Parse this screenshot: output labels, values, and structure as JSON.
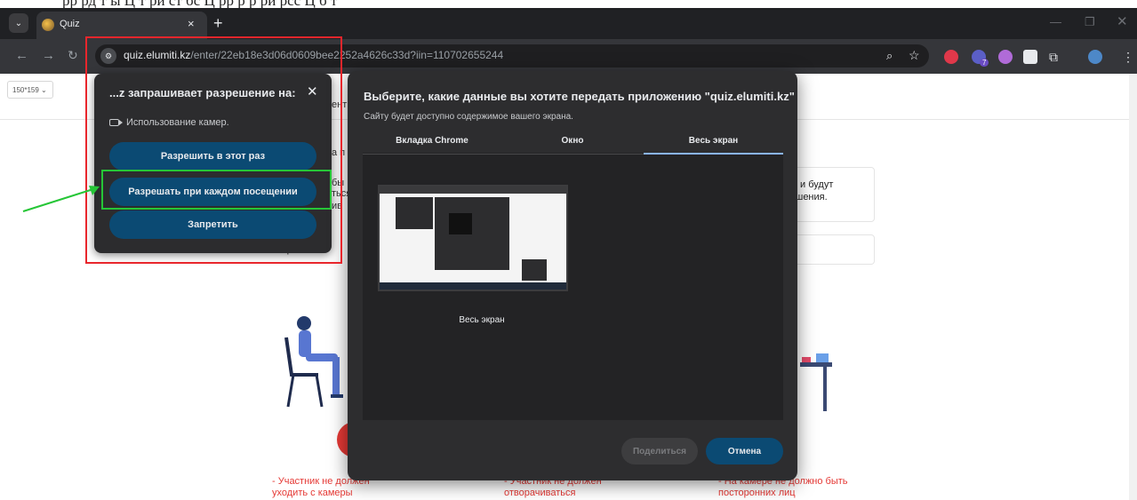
{
  "document_strip": {
    "text": "рр рд т ы Ц т ри ст бс Ц рр р р ри рсс Ц б т"
  },
  "browser": {
    "tab_title": "Quiz",
    "tab_close": "×",
    "new_tab": "+",
    "url_host": "quiz.elumiti.kz",
    "url_path": "/enter/22eb18e3d06d0609bee2252a4626c33d?iin=110702655244",
    "extension_badge": "7"
  },
  "page": {
    "zoom_select": "150*159",
    "rule_text": "ны и будут\nрушения.",
    "peek_texts": {
      "peek1": "ент",
      "peek2": "а п",
      "peek3": "бы",
      "peek4": "ться",
      "peek5": "ив",
      "peek6": "стир"
    },
    "captions": [
      "- Участник не должен\nуходить с камеры",
      "- Участник не должен\nотворачиваться",
      "- На камере не должно быть\nпосторонних лиц"
    ]
  },
  "permission_popup": {
    "title": "...z запрашивает разрешение на:",
    "close": "✕",
    "camera_label": "Использование камер.",
    "allow_once": "Разрешить в этот раз",
    "allow_always": "Разрешать при каждом посещении",
    "deny": "Запретить"
  },
  "share_dialog": {
    "title": "Выберите, какие данные вы хотите передать приложению \"quiz.elumiti.kz\"",
    "subtitle": "Сайту будет доступно содержимое вашего экрана.",
    "tabs": [
      "Вкладка Chrome",
      "Окно",
      "Весь экран"
    ],
    "selected_tab": "Весь экран",
    "thumbnail_label": "Весь экран",
    "share_button": "Поделиться",
    "cancel_button": "Отмена"
  },
  "colors": {
    "accent_blue": "#0b4a73",
    "highlight_red": "#e8262c",
    "highlight_green": "#26c637",
    "warning_red": "#e53935",
    "tab_underline": "#8ab4f8"
  }
}
